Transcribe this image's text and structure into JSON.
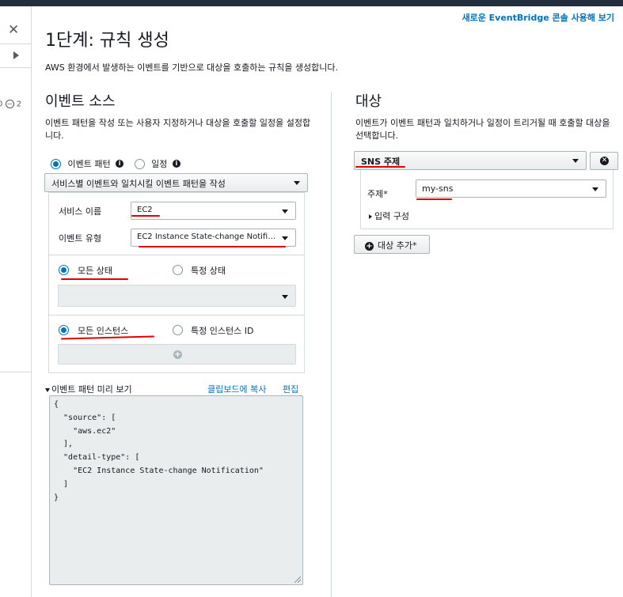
{
  "header": {
    "new_console_link": "새로운 EventBridge 콘솔 사용해 보기"
  },
  "sidebar": {
    "close_glyph": "✕",
    "count_left": "0",
    "count_right": "2"
  },
  "page": {
    "title": "1단계: 규칙 생성",
    "description": "AWS 환경에서 발생하는 이벤트를 기반으로 대상을 호출하는 규칙을 생성합니다."
  },
  "event_source": {
    "heading": "이벤트 소스",
    "description": "이벤트 패턴을 작성 또는 사용자 지정하거나 대상을 호출할 일정을 설정합니다.",
    "option_pattern": "이벤트 패턴",
    "option_schedule": "일정",
    "selected_option": "이벤트 패턴",
    "pattern_builder_button": "서비스별 이벤트와 일치시킬 이벤트 패턴을 작성",
    "service_name_label": "서비스 이름",
    "service_name_value": "EC2",
    "event_type_label": "이벤트 유형",
    "event_type_value": "EC2 Instance State-change Notification",
    "state_any": "모든 상태",
    "state_specific": "특정 상태",
    "state_selected": "모든 상태",
    "instance_any": "모든 인스턴스",
    "instance_specific": "특정 인스턴스 ID",
    "instance_selected": "모든 인스턴스",
    "preview_heading": "이벤트 패턴 미리 보기",
    "copy_link": "클립보드에 복사",
    "edit_link": "편집",
    "preview_code": "{\n  \"source\": [\n    \"aws.ec2\"\n  ],\n  \"detail-type\": [\n    \"EC2 Instance State-change Notification\"\n  ]\n}"
  },
  "targets": {
    "heading": "대상",
    "description": "이벤트가 이벤트 패턴과 일치하거나 일정이 트리거될 때 호출할 대상을 선택합니다.",
    "target_type": "SNS 주제",
    "topic_label": "주제*",
    "topic_value": "my-sns",
    "configure_input": "입력 구성",
    "remove_glyph": "✕",
    "add_target_button": "대상 추가*",
    "plus_glyph": "+"
  },
  "colors": {
    "link": "#0073bb",
    "annotation_red": "#e00000",
    "topbar": "#232f3e"
  }
}
